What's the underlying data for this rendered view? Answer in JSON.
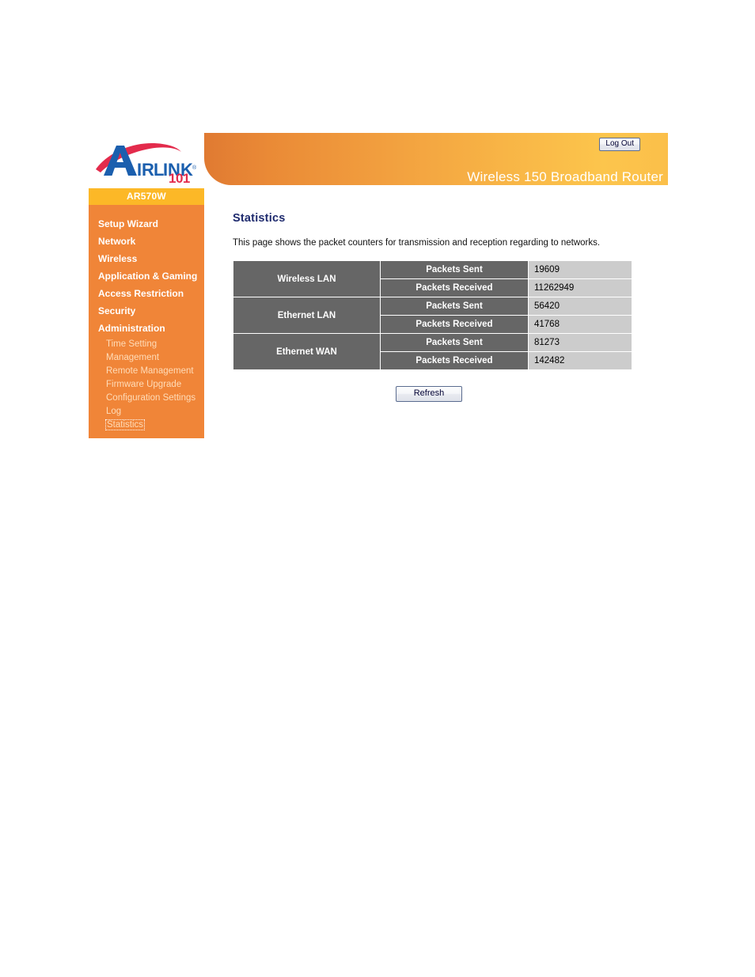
{
  "header": {
    "logo": {
      "brand": "AIRLINK",
      "sub": "101",
      "trademark": "®"
    },
    "product_title": "Wireless 150 Broadband Router",
    "logout_label": "Log Out",
    "gradient_start": "#e07a32",
    "gradient_end": "#fbbf4a"
  },
  "sidebar": {
    "model": "AR570W",
    "model_band_color": "#fcb827",
    "background_color": "#f08538",
    "items": [
      {
        "label": "Setup Wizard"
      },
      {
        "label": "Network"
      },
      {
        "label": "Wireless"
      },
      {
        "label": "Application & Gaming"
      },
      {
        "label": "Access Restriction"
      },
      {
        "label": "Security"
      },
      {
        "label": "Administration"
      }
    ],
    "subitems": [
      {
        "label": "Time Setting",
        "active": false
      },
      {
        "label": "Management",
        "active": false
      },
      {
        "label": "Remote Management",
        "active": false
      },
      {
        "label": "Firmware Upgrade",
        "active": false
      },
      {
        "label": "Configuration Settings",
        "active": false
      },
      {
        "label": "Log",
        "active": false
      },
      {
        "label": "Statistics",
        "active": true
      }
    ]
  },
  "main": {
    "title": "Statistics",
    "title_color": "#1f2b6e",
    "description": "This page shows the packet counters for transmission and reception regarding to networks.",
    "table": {
      "header_cell_color": "#666666",
      "value_cell_color": "#cccccc",
      "rows": [
        {
          "interface": "Wireless LAN",
          "metrics": [
            {
              "label": "Packets Sent",
              "value": "19609"
            },
            {
              "label": "Packets Received",
              "value": "11262949"
            }
          ]
        },
        {
          "interface": "Ethernet LAN",
          "metrics": [
            {
              "label": "Packets Sent",
              "value": "56420"
            },
            {
              "label": "Packets Received",
              "value": "41768"
            }
          ]
        },
        {
          "interface": "Ethernet WAN",
          "metrics": [
            {
              "label": "Packets Sent",
              "value": "81273"
            },
            {
              "label": "Packets Received",
              "value": "142482"
            }
          ]
        }
      ]
    },
    "refresh_label": "Refresh"
  }
}
